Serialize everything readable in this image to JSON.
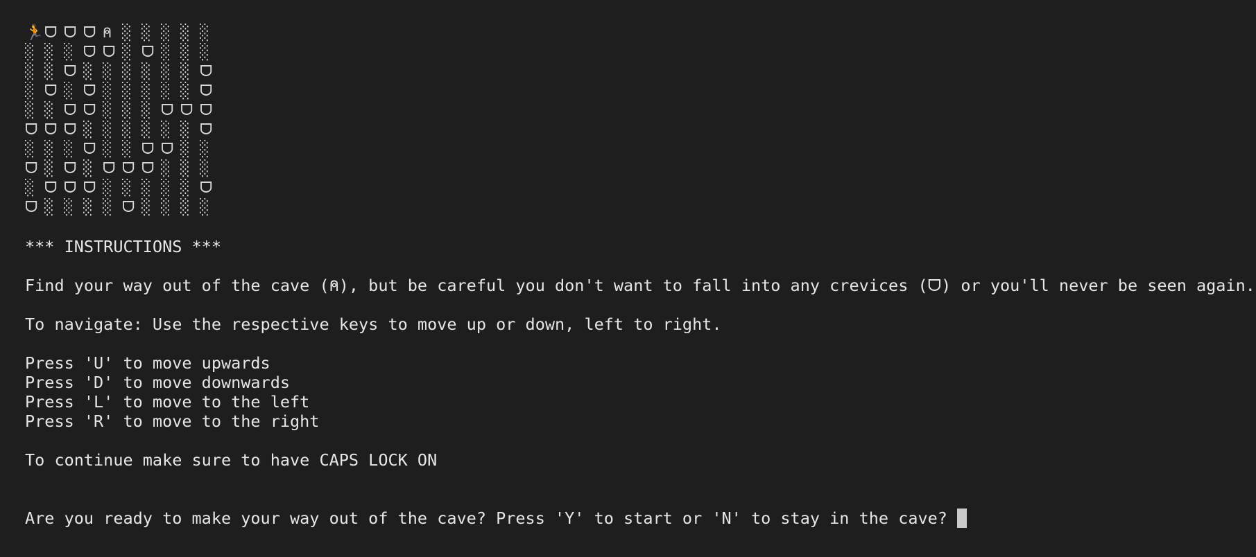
{
  "terminal": {
    "grid": [
      [
        "🏃",
        "ᗜ",
        "ᗜ",
        "ᗜ",
        "⍝",
        "░",
        "░",
        "░",
        "░",
        "░"
      ],
      [
        "░",
        "░",
        "░",
        "ᗜ",
        "ᗜ",
        "░",
        "ᗜ",
        "░",
        "░",
        "░"
      ],
      [
        "░",
        "░",
        "ᗜ",
        "░",
        "░",
        "░",
        "░",
        "░",
        "░",
        "ᗜ"
      ],
      [
        "░",
        "ᗜ",
        "░",
        "ᗜ",
        "░",
        "░",
        "░",
        "░",
        "░",
        "ᗜ"
      ],
      [
        "░",
        "░",
        "ᗜ",
        "ᗜ",
        "░",
        "░",
        "░",
        "ᗜ",
        "ᗜ",
        "ᗜ"
      ],
      [
        "ᗜ",
        "ᗜ",
        "ᗜ",
        "░",
        "░",
        "░",
        "░",
        "░",
        "░",
        "ᗜ"
      ],
      [
        "░",
        "░",
        "░",
        "ᗜ",
        "░",
        "░",
        "ᗜ",
        "ᗜ",
        "░",
        "░"
      ],
      [
        "ᗜ",
        "░",
        "ᗜ",
        "░",
        "ᗜ",
        "ᗜ",
        "ᗜ",
        "░",
        "░",
        "░"
      ],
      [
        "░",
        "ᗜ",
        "ᗜ",
        "ᗜ",
        "░",
        "░",
        "░",
        "░",
        "░",
        "ᗜ"
      ],
      [
        "ᗜ",
        "░",
        "░",
        "░",
        "░",
        "ᗜ",
        "░",
        "░",
        "░",
        "░"
      ]
    ],
    "heading": "*** INSTRUCTIONS ***",
    "intro": "Find your way out of the cave (⍝), but be careful you don't want to fall into any crevices (ᗜ) or you'll never be seen again.",
    "navigate": "To navigate: Use the respective keys to move up or down, left to right.",
    "keys": [
      "Press 'U' to move upwards",
      "Press 'D' to move downwards",
      "Press 'L' to move to the left",
      "Press 'R' to move to the right"
    ],
    "caps_note": "To continue make sure to have CAPS LOCK ON",
    "prompt": "Are you ready to make your way out of the cave? Press 'Y' to start or 'N' to stay in the cave?",
    "colors": {
      "background": "#1e1e1e",
      "text": "#e6e6e6",
      "cursor": "#c9c9c9"
    },
    "icons": {
      "player": "runner-icon",
      "exit": "cave-exit-icon",
      "crevice": "crevice-icon",
      "floor": "floor-tile-icon"
    }
  }
}
